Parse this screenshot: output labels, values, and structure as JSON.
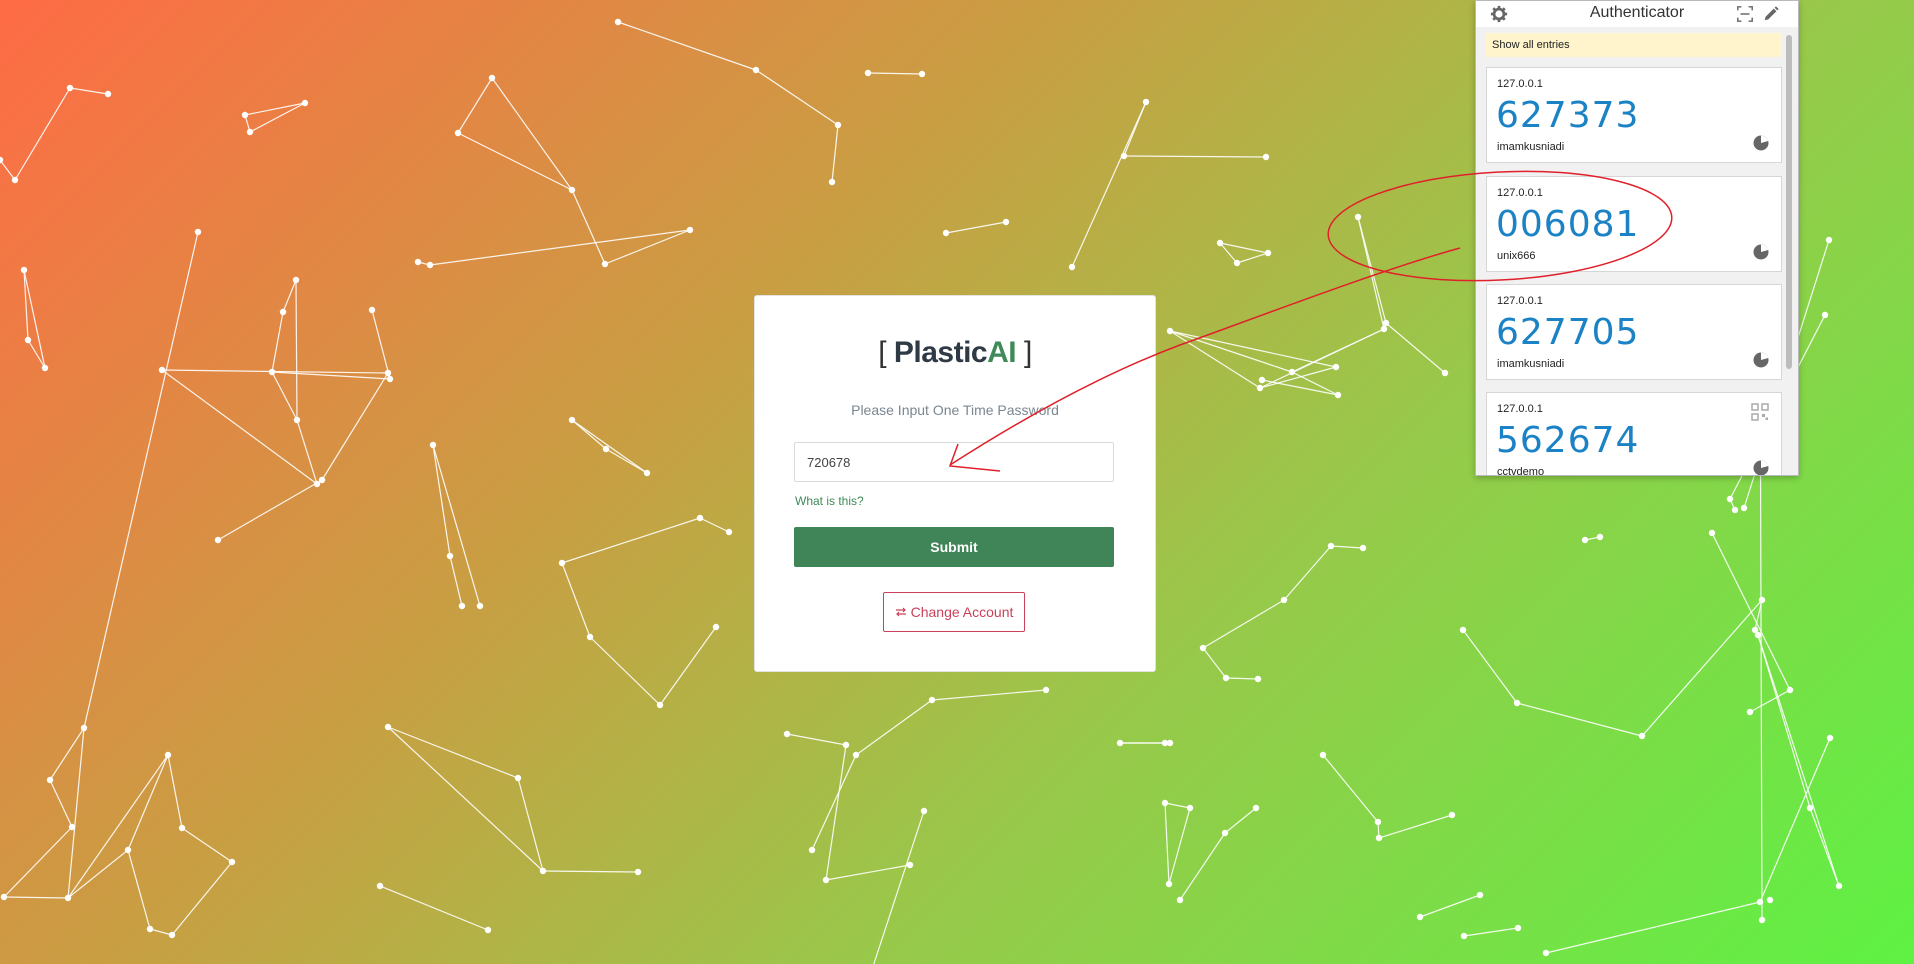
{
  "login": {
    "logo": {
      "open_bracket": "[",
      "brand_plain": "Plastic",
      "brand_accent": "AI",
      "close_bracket": "]"
    },
    "subtitle": "Please Input One Time Password",
    "otp_value": "720678",
    "help_link": "What is this?",
    "submit_label": "Submit",
    "change_account_label": "Change Account",
    "change_account_icon": "swap-arrows-icon"
  },
  "authenticator": {
    "title": "Authenticator",
    "header_icons": [
      "gear-icon",
      "scan-qr-icon",
      "pencil-icon"
    ],
    "notice": "Show all entries",
    "entries": [
      {
        "issuer": "127.0.0.1",
        "code": "627373",
        "account": "imamkusniadi"
      },
      {
        "issuer": "127.0.0.1",
        "code": "006081",
        "account": "unix666"
      },
      {
        "issuer": "127.0.0.1",
        "code": "627705",
        "account": "imamkusniadi"
      },
      {
        "issuer": "127.0.0.1",
        "code": "562674",
        "account": "cctvdemo"
      }
    ]
  },
  "colors": {
    "brand_green": "#3f8557",
    "change_account_red": "#c9415a",
    "otp_blue": "#1b82c5",
    "annotation_red": "#e0202a"
  }
}
